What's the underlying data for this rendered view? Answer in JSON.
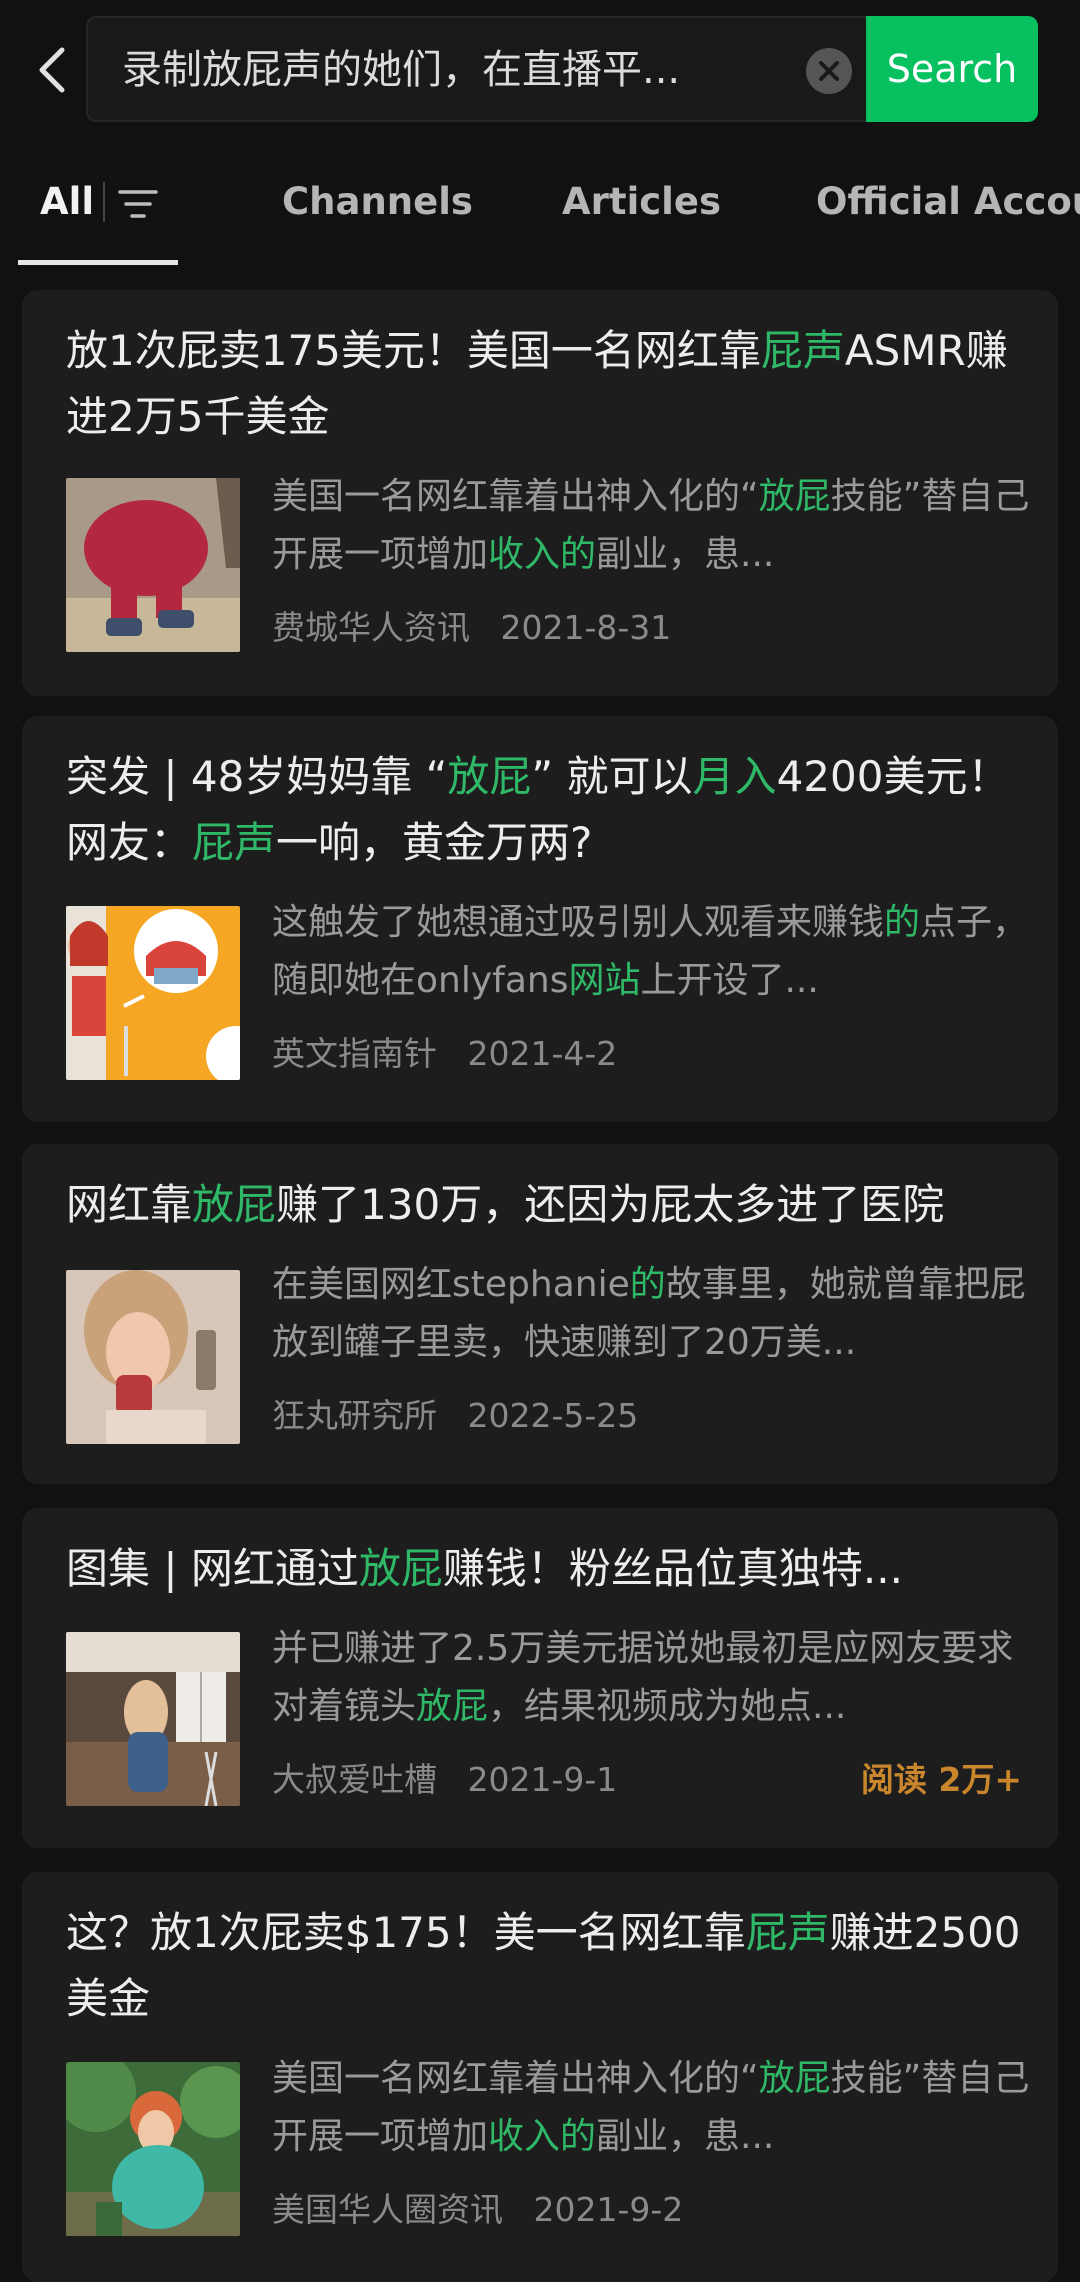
{
  "search": {
    "query": "录制放屁声的她们，在直播平...",
    "button_label": "Search"
  },
  "tabs": [
    {
      "label": "All"
    },
    {
      "label": "Channels"
    },
    {
      "label": "Articles"
    },
    {
      "label": "Official Accou"
    }
  ],
  "colors": {
    "accent": "#07c160",
    "highlight": "#2fb867",
    "reads": "#c9862c",
    "background": "#111111",
    "card": "#1d1d1d"
  },
  "results": [
    {
      "title": [
        [
          "放1次屁卖175美元！美国一名网红靠",
          false
        ],
        [
          "屁声",
          true
        ],
        [
          "ASMR赚进2万5千美金",
          false
        ]
      ],
      "snippet": [
        [
          "美国一名网红靠着出神入化的“",
          false
        ],
        [
          "放屁",
          true
        ],
        [
          "技能”替自己开展一项增加",
          false
        ],
        [
          "收入的",
          true
        ],
        [
          "副业，患...",
          false
        ]
      ],
      "source": "费城华人资讯",
      "date": "2021-8-31",
      "reads": ""
    },
    {
      "title": [
        [
          "突发 | 48岁妈妈靠 “",
          false
        ],
        [
          "放屁",
          true
        ],
        [
          "” 就可以",
          false
        ],
        [
          "月入",
          true
        ],
        [
          "4200美元！网友：",
          false
        ],
        [
          "屁声",
          true
        ],
        [
          "一响，黄金万两?",
          false
        ]
      ],
      "snippet": [
        [
          "这触发了她想通过吸引别人观看来赚钱",
          false
        ],
        [
          "的",
          true
        ],
        [
          "点子，随即她在onlyfans",
          false
        ],
        [
          "网站",
          true
        ],
        [
          "上开设了...",
          false
        ]
      ],
      "source": "英文指南针",
      "date": "2021-4-2",
      "reads": ""
    },
    {
      "title": [
        [
          "网红靠",
          false
        ],
        [
          "放屁",
          true
        ],
        [
          "赚了130万，还因为屁太多进了医院",
          false
        ]
      ],
      "snippet": [
        [
          "在美国网红stephanie",
          false
        ],
        [
          "的",
          true
        ],
        [
          "故事里，她就曾靠把屁放到罐子里卖，快速赚到了20万美...",
          false
        ]
      ],
      "source": "狂丸研究所",
      "date": "2022-5-25",
      "reads": ""
    },
    {
      "title": [
        [
          "图集 | 网红通过",
          false
        ],
        [
          "放屁",
          true
        ],
        [
          "赚钱！粉丝品位真独特...",
          false
        ]
      ],
      "snippet": [
        [
          "并已赚进了2.5万美元据说她最初是应网友要求对着镜头",
          false
        ],
        [
          "放屁",
          true
        ],
        [
          "，结果视频成为她点...",
          false
        ]
      ],
      "source": "大叔爱吐槽",
      "date": "2021-9-1",
      "reads": "阅读 2万+"
    },
    {
      "title": [
        [
          "这？放1次屁卖$175！美一名网红靠",
          false
        ],
        [
          "屁声",
          true
        ],
        [
          "赚进2500美金",
          false
        ]
      ],
      "snippet": [
        [
          "美国一名网红靠着出神入化的“",
          false
        ],
        [
          "放屁",
          true
        ],
        [
          "技能”替自己开展一项增加",
          false
        ],
        [
          "收入的",
          true
        ],
        [
          "副业，患...",
          false
        ]
      ],
      "source": "美国华人圈资讯",
      "date": "2021-9-2",
      "reads": ""
    }
  ]
}
